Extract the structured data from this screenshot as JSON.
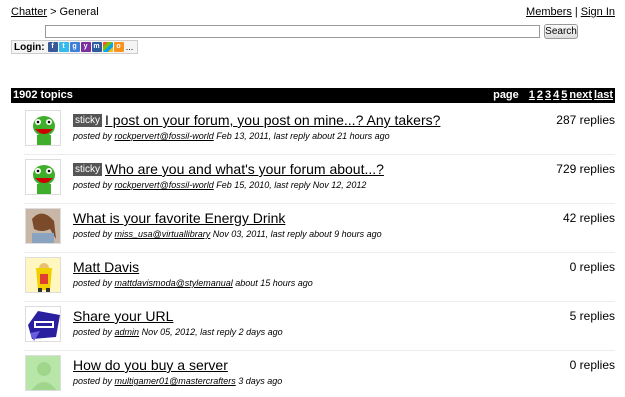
{
  "breadcrumb": {
    "root": "Chatter",
    "sep": ">",
    "current": "General"
  },
  "toplinks": {
    "members": "Members",
    "sep": "|",
    "signin": "Sign In"
  },
  "search": {
    "value": "",
    "button": "Search"
  },
  "login": {
    "label": "Login:",
    "providers": [
      "facebook-icon",
      "twitter-icon",
      "google-icon",
      "yahoo-icon",
      "myspace-icon",
      "windows-live-icon",
      "openid-icon"
    ],
    "more": "..."
  },
  "header": {
    "count": "1902 topics",
    "page_label": "page",
    "pages": [
      "1",
      "2",
      "3",
      "4",
      "5"
    ],
    "next": "next",
    "last": "last"
  },
  "topics": [
    {
      "sticky": "sticky",
      "title": "I post on your forum, you post on mine...? Any takers?",
      "posted_by": "posted by",
      "author": "rockpervert@fossil-world",
      "date": "Feb 13, 2011, last reply about 21 hours ago",
      "replies": "287 replies",
      "avatar": "green-monster"
    },
    {
      "sticky": "sticky",
      "title": "Who are you and what's your forum about...?",
      "posted_by": "posted by",
      "author": "rockpervert@fossil-world",
      "date": "Feb 15, 2010, last reply Nov 12, 2012",
      "replies": "729 replies",
      "avatar": "green-monster"
    },
    {
      "sticky": "",
      "title": "What is your favorite Energy Drink",
      "posted_by": "posted by",
      "author": "miss_usa@virtuallibrary",
      "date": "Nov 03, 2011, last reply about 9 hours ago",
      "replies": "42 replies",
      "avatar": "photo-person"
    },
    {
      "sticky": "",
      "title": "Matt Davis",
      "posted_by": "posted by",
      "author": "mattdavismoda@stylemanual",
      "date": "about 15 hours ago",
      "replies": "0 replies",
      "avatar": "yellow-figure"
    },
    {
      "sticky": "",
      "title": "Share your URL",
      "posted_by": "posted by",
      "author": "admin",
      "date": "Nov 05, 2012, last reply 2 days ago",
      "replies": "5 replies",
      "avatar": "purple-logo"
    },
    {
      "sticky": "",
      "title": "How do you buy a server",
      "posted_by": "posted by",
      "author": "multigamer01@mastercrafters",
      "date": "3 days ago",
      "replies": "0 replies",
      "avatar": "default-silhouette"
    }
  ]
}
